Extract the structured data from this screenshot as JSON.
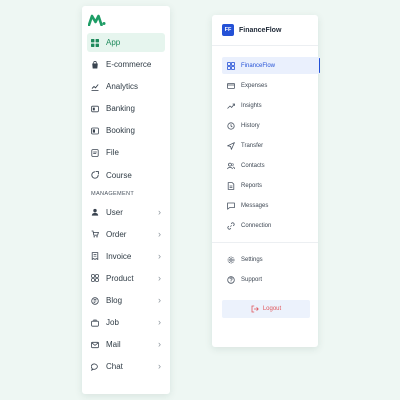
{
  "left_sidebar": {
    "logo_icon": "brand-m-logo",
    "items": [
      {
        "label": "App",
        "icon": "grid-icon",
        "active": true
      },
      {
        "label": "E-commerce",
        "icon": "bag-icon"
      },
      {
        "label": "Analytics",
        "icon": "chart-icon"
      },
      {
        "label": "Banking",
        "icon": "bank-icon"
      },
      {
        "label": "Booking",
        "icon": "booking-icon"
      },
      {
        "label": "File",
        "icon": "file-icon"
      },
      {
        "label": "Course",
        "icon": "course-icon"
      }
    ],
    "section_title": "MANAGEMENT",
    "management_items": [
      {
        "label": "User",
        "icon": "user-icon"
      },
      {
        "label": "Order",
        "icon": "order-icon"
      },
      {
        "label": "Invoice",
        "icon": "invoice-icon"
      },
      {
        "label": "Product",
        "icon": "product-icon"
      },
      {
        "label": "Blog",
        "icon": "blog-icon"
      },
      {
        "label": "Job",
        "icon": "job-icon"
      },
      {
        "label": "Mail",
        "icon": "mail-icon"
      },
      {
        "label": "Chat",
        "icon": "chat-icon"
      }
    ],
    "chevron": "›",
    "accent_color": "#1e8a5c"
  },
  "right_panel": {
    "badge": "FF",
    "title": "FinanceFlow",
    "items": [
      {
        "label": "FinanceFlow",
        "icon": "dashboard-icon",
        "active": true
      },
      {
        "label": "Expenses",
        "icon": "credit-card-icon"
      },
      {
        "label": "Insights",
        "icon": "trend-icon"
      },
      {
        "label": "History",
        "icon": "history-icon"
      },
      {
        "label": "Transfer",
        "icon": "send-icon"
      },
      {
        "label": "Contacts",
        "icon": "contacts-icon"
      },
      {
        "label": "Reports",
        "icon": "report-icon"
      },
      {
        "label": "Messages",
        "icon": "message-icon"
      },
      {
        "label": "Connection",
        "icon": "link-icon"
      }
    ],
    "bottom_items": [
      {
        "label": "Settings",
        "icon": "settings-icon"
      },
      {
        "label": "Support",
        "icon": "help-icon"
      }
    ],
    "logout_label": "Logout",
    "accent_color": "#2451d6",
    "logout_color": "#e0565b"
  }
}
